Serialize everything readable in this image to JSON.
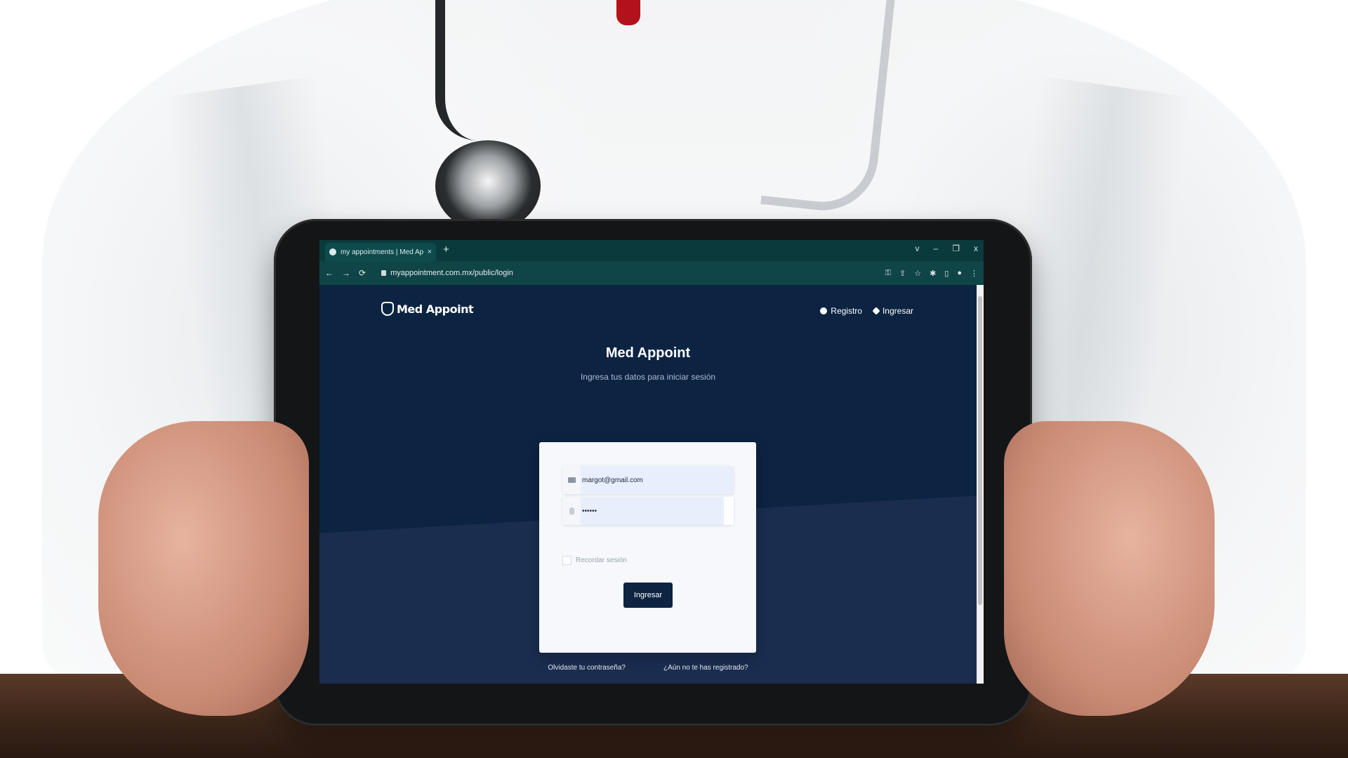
{
  "browser": {
    "tab_title": "my appointments | Med Appoint",
    "tab_close": "×",
    "new_tab": "+",
    "window_controls": [
      "v",
      "–",
      "❐",
      "x"
    ],
    "url": "myappointment.com.mx/public/login"
  },
  "site": {
    "brand": "Med Appoint",
    "nav": {
      "register_label": "Registro",
      "login_label": "Ingresar"
    }
  },
  "hero": {
    "title": "Med Appoint",
    "subtitle": "Ingresa tus datos para iniciar sesión"
  },
  "login_form": {
    "email_value": "margot@gmail.com",
    "password_value": "••••••",
    "remember_label": "Recordar sesión",
    "submit_label": "Ingresar"
  },
  "footer_links": {
    "forgot_password": "Olvidaste tu contraseña?",
    "not_registered": "¿Aún no te has registrado?"
  },
  "colors": {
    "page_bg": "#0c2342",
    "browser_chrome": "#0f4547",
    "card_bg": "#f6f8fb",
    "button_bg": "#0c2342"
  }
}
